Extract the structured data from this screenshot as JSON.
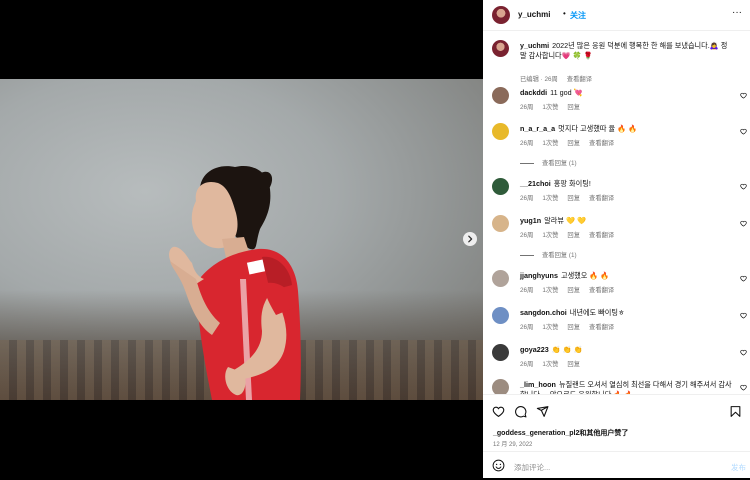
{
  "post": {
    "username": "y_uchmi",
    "dot": "•",
    "follow_label": "关注",
    "more_label": "···"
  },
  "caption": {
    "username": "y_uchmi",
    "text": "2022년 많은 응원 덕분에 행복한 한 해를 보냈습니다.🙇‍♀️ 정말 감사합니다💗 🍀 🌹",
    "edited": "已编辑 · 26周",
    "translate": "查看翻译"
  },
  "comments": [
    {
      "username": "dackddi",
      "text": "11 god 💘",
      "age": "26周",
      "likes": "1次赞",
      "reply": "回复",
      "translate": ""
    },
    {
      "username": "n_a_r_a_a",
      "text": "멋지다 고생했따 율 🔥 🔥",
      "age": "26周",
      "likes": "1次赞",
      "reply": "回复",
      "translate": "查看翻译",
      "view_replies": "查看回复 (1)"
    },
    {
      "username": "__21choi",
      "text": "홍팡 화이팅!",
      "age": "26周",
      "likes": "1次赞",
      "reply": "回复",
      "translate": "查看翻译"
    },
    {
      "username": "yug1n",
      "text": "알라뷰 💛 💛",
      "age": "26周",
      "likes": "1次赞",
      "reply": "回复",
      "translate": "查看翻译",
      "view_replies": "查看回复 (1)"
    },
    {
      "username": "jjanghyuns",
      "text": "고생했오 🔥 🔥",
      "age": "26周",
      "likes": "1次赞",
      "reply": "回复",
      "translate": "查看翻译"
    },
    {
      "username": "sangdon.choi",
      "text": "내년에도 빠이팅ㅎ",
      "age": "26周",
      "likes": "1次赞",
      "reply": "回复",
      "translate": "查看翻译"
    },
    {
      "username": "goya223",
      "text": "👏 👏 👏",
      "age": "26周",
      "likes": "1次赞",
      "reply": "回复",
      "translate": ""
    },
    {
      "username": "_lim_hoon",
      "text": "뉴질랜드 오셔서 열심히 최선을 다해서 경기 해주셔서 감사합니다 ... 앞으로도 응원합니다 🔥 🔥",
      "age": "",
      "likes": "",
      "reply": "",
      "translate": ""
    }
  ],
  "likes_line": "_goddess_generation_pl2和其他用户赞了",
  "date": "12 月 29, 2022",
  "add_comment": {
    "placeholder": "添加评论...",
    "post": "发布"
  },
  "colors": {
    "accent": "#0095f6",
    "muted": "#737373",
    "jersey": "#d8262f"
  },
  "icons": [
    "more-icon",
    "next-arrow-icon",
    "heart-icon",
    "comment-icon",
    "share-icon",
    "bookmark-icon",
    "emoji-icon"
  ]
}
